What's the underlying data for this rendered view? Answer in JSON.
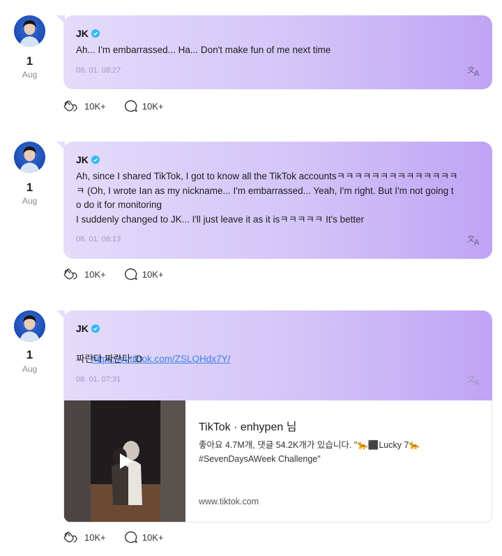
{
  "posts": [
    {
      "author": "JK",
      "date_day": "1",
      "date_month": "Aug",
      "message": "Ah... I'm embarrassed... Ha... Don't make fun of me next time",
      "timestamp": "08. 01. 08:27",
      "likes": "10K+",
      "comments": "10K+"
    },
    {
      "author": "JK",
      "date_day": "1",
      "date_month": "Aug",
      "message": "Ah, since I shared TikTok, I got to know all the TikTok accountsㅋㅋㅋㅋㅋㅋㅋㅋㅋㅋㅋㅋㅋㅋ\nㅋ (Oh, I wrote Ian as my nickname... I'm embarrassed... Yeah, I'm right. But I'm not going t\no do it for monitoring\nI suddenly changed to JK... I'll just leave it as it isㅋㅋㅋㅋㅋ It's better",
      "timestamp": "08. 01. 08:13",
      "likes": "10K+",
      "comments": "10K+"
    },
    {
      "author": "JK",
      "date_day": "1",
      "date_month": "Aug",
      "link": "https://vt.tiktok.com/ZSLQHdx7Y/",
      "message": "짜란다 짜란다 :D",
      "timestamp": "08. 01. 07:31",
      "likes": "10K+",
      "comments": "10K+",
      "card": {
        "title": "TikTok · enhypen 님",
        "description": "좋아요 4.7M개, 댓글 54.2K개가 있습니다. \"🐆⬛Lucky 7🐆 #SevenDaysAWeek Challenge\"",
        "url": "www.tiktok.com"
      }
    }
  ],
  "icons": {
    "like": "heart-hands-icon",
    "comment": "speech-bubble-icon",
    "translate": "translate-icon",
    "verified": "verified-badge-icon",
    "play": "play-icon"
  },
  "colors": {
    "bubble_start": "#e4dcfa",
    "bubble_end": "#bfa4f4",
    "link": "#3b7ee8",
    "verified": "#34b9f2"
  }
}
